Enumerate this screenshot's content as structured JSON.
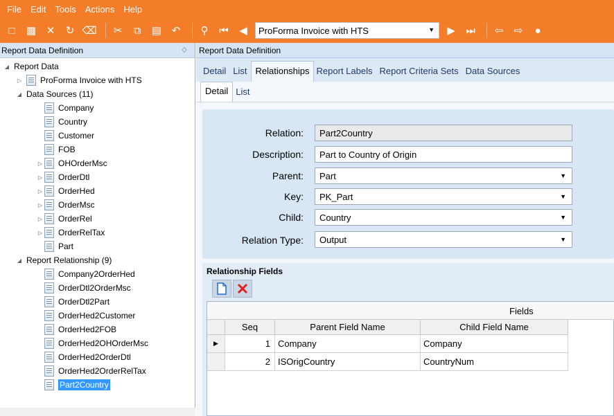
{
  "menu": [
    "File",
    "Edit",
    "Tools",
    "Actions",
    "Help"
  ],
  "toolbar": {
    "combo_value": "ProForma Invoice with HTS",
    "icons": [
      "new-icon",
      "save-icon",
      "delete-icon",
      "refresh-icon",
      "clear-icon",
      "cut-icon",
      "copy-icon",
      "paste-icon",
      "undo-icon",
      "search-icon",
      "first-icon",
      "prev-icon",
      "next-icon",
      "last-icon",
      "back-icon",
      "forward-icon",
      "home-icon"
    ]
  },
  "left_panel": {
    "title": "Report Data Definition",
    "tree": {
      "root": "Report Data",
      "report": "ProForma Invoice with HTS",
      "data_sources_label": "Data Sources (11)",
      "data_sources": [
        "Company",
        "Country",
        "Customer",
        "FOB",
        "OHOrderMsc",
        "OrderDtl",
        "OrderHed",
        "OrderMsc",
        "OrderRel",
        "OrderRelTax",
        "Part"
      ],
      "relationships_label": "Report Relationship (9)",
      "relationships": [
        "Company2OrderHed",
        "OrderDtl2OrderMsc",
        "OrderDtl2Part",
        "OrderHed2Customer",
        "OrderHed2FOB",
        "OrderHed2OHOrderMsc",
        "OrderHed2OrderDtl",
        "OrderHed2OrderRelTax",
        "Part2Country"
      ]
    }
  },
  "right_panel": {
    "title": "Report Data Definition",
    "tabs": [
      "Detail",
      "List",
      "Relationships",
      "Report Labels",
      "Report Criteria Sets",
      "Data Sources"
    ],
    "subtabs": [
      "Detail",
      "List"
    ]
  },
  "form": {
    "relation_label": "Relation:",
    "relation_value": "Part2Country",
    "description_label": "Description:",
    "description_value": "Part to Country of Origin",
    "parent_label": "Parent:",
    "parent_value": "Part",
    "key_label": "Key:",
    "key_value": "PK_Part",
    "child_label": "Child:",
    "child_value": "Country",
    "relation_type_label": "Relation Type:",
    "relation_type_value": "Output"
  },
  "fields": {
    "title": "Relationship Fields",
    "band": "Fields",
    "columns": [
      "Seq",
      "Parent Field Name",
      "Child Field Name"
    ],
    "rows": [
      {
        "seq": "1",
        "parent": "Company",
        "child": "Company"
      },
      {
        "seq": "2",
        "parent": "ISOrigCountry",
        "child": "CountryNum"
      }
    ]
  },
  "colors": {
    "accent": "#f47d2a",
    "selection": "#3399ff",
    "panel_header": "#d6e4f5"
  }
}
